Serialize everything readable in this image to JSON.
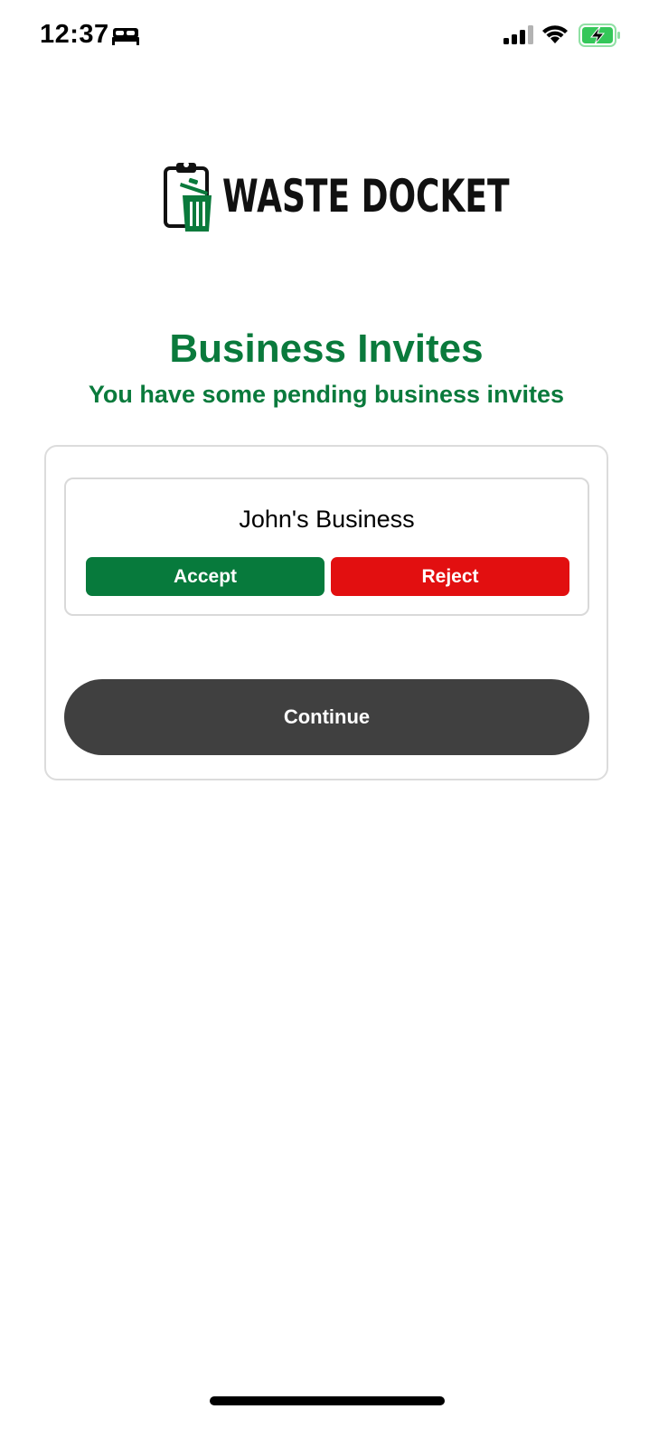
{
  "status_bar": {
    "time": "12:37",
    "icons": [
      "sleep-icon",
      "cellular-signal-icon",
      "wifi-icon",
      "battery-charging-icon"
    ],
    "battery_color": "#34c759"
  },
  "logo": {
    "text": "WASTE DOCKET",
    "icon": "clipboard-trash-icon",
    "accent_color": "#0a7a3c"
  },
  "header": {
    "title": "Business Invites",
    "subtitle": "You have some pending business invites",
    "color": "#0a7a3c"
  },
  "invites": [
    {
      "business_name": "John's Business",
      "accept_label": "Accept",
      "reject_label": "Reject"
    }
  ],
  "actions": {
    "continue_label": "Continue"
  },
  "colors": {
    "accept": "#077a3c",
    "reject": "#e20f10",
    "continue": "#404040"
  }
}
